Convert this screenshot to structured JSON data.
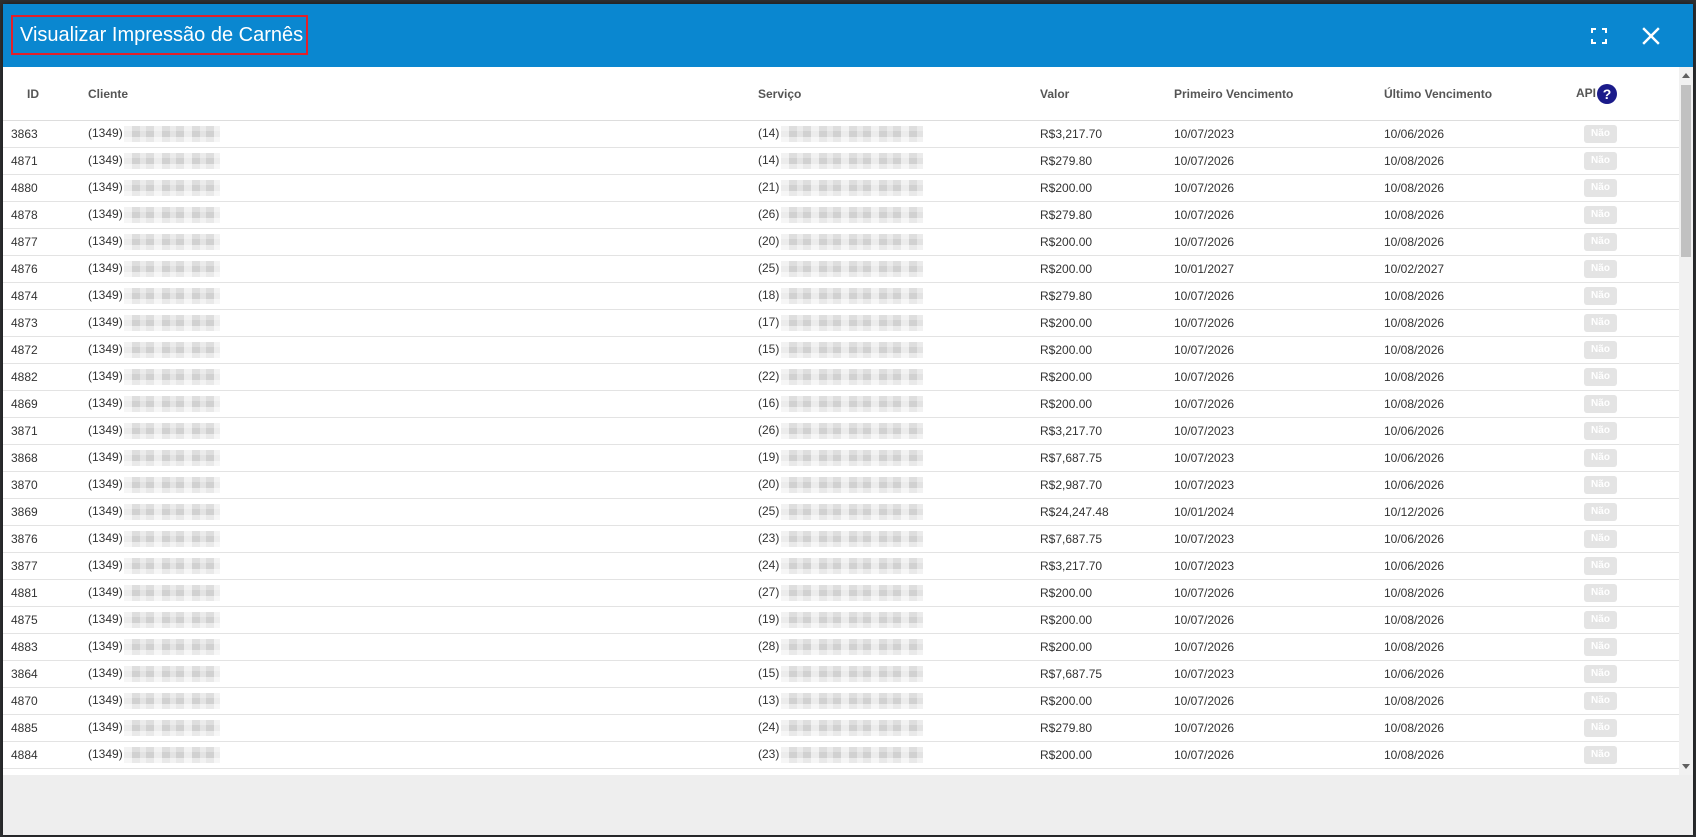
{
  "modal": {
    "title": "Visualizar Impressão de Carnês",
    "header_color": "#0a87d0"
  },
  "table": {
    "columns": {
      "id": "ID",
      "cliente": "Cliente",
      "servico": "Serviço",
      "valor": "Valor",
      "primeiro_vencimento": "Primeiro Vencimento",
      "ultimo_vencimento": "Último Vencimento",
      "api": "API"
    },
    "help_icon": "question-circle-icon",
    "rows": [
      {
        "id": "3863",
        "cliente": "(1349)",
        "servico": "(14)",
        "valor": "R$3,217.70",
        "pv": "10/07/2023",
        "uv": "10/06/2026",
        "api": "Não"
      },
      {
        "id": "4871",
        "cliente": "(1349)",
        "servico": "(14)",
        "valor": "R$279.80",
        "pv": "10/07/2026",
        "uv": "10/08/2026",
        "api": "Não"
      },
      {
        "id": "4880",
        "cliente": "(1349)",
        "servico": "(21)",
        "valor": "R$200.00",
        "pv": "10/07/2026",
        "uv": "10/08/2026",
        "api": "Não"
      },
      {
        "id": "4878",
        "cliente": "(1349)",
        "servico": "(26)",
        "valor": "R$279.80",
        "pv": "10/07/2026",
        "uv": "10/08/2026",
        "api": "Não"
      },
      {
        "id": "4877",
        "cliente": "(1349)",
        "servico": "(20)",
        "valor": "R$200.00",
        "pv": "10/07/2026",
        "uv": "10/08/2026",
        "api": "Não"
      },
      {
        "id": "4876",
        "cliente": "(1349)",
        "servico": "(25)",
        "valor": "R$200.00",
        "pv": "10/01/2027",
        "uv": "10/02/2027",
        "api": "Não"
      },
      {
        "id": "4874",
        "cliente": "(1349)",
        "servico": "(18)",
        "valor": "R$279.80",
        "pv": "10/07/2026",
        "uv": "10/08/2026",
        "api": "Não"
      },
      {
        "id": "4873",
        "cliente": "(1349)",
        "servico": "(17)",
        "valor": "R$200.00",
        "pv": "10/07/2026",
        "uv": "10/08/2026",
        "api": "Não"
      },
      {
        "id": "4872",
        "cliente": "(1349)",
        "servico": "(15)",
        "valor": "R$200.00",
        "pv": "10/07/2026",
        "uv": "10/08/2026",
        "api": "Não"
      },
      {
        "id": "4882",
        "cliente": "(1349)",
        "servico": "(22)",
        "valor": "R$200.00",
        "pv": "10/07/2026",
        "uv": "10/08/2026",
        "api": "Não"
      },
      {
        "id": "4869",
        "cliente": "(1349)",
        "servico": "(16)",
        "valor": "R$200.00",
        "pv": "10/07/2026",
        "uv": "10/08/2026",
        "api": "Não"
      },
      {
        "id": "3871",
        "cliente": "(1349)",
        "servico": "(26)",
        "valor": "R$3,217.70",
        "pv": "10/07/2023",
        "uv": "10/06/2026",
        "api": "Não"
      },
      {
        "id": "3868",
        "cliente": "(1349)",
        "servico": "(19)",
        "valor": "R$7,687.75",
        "pv": "10/07/2023",
        "uv": "10/06/2026",
        "api": "Não"
      },
      {
        "id": "3870",
        "cliente": "(1349)",
        "servico": "(20)",
        "valor": "R$2,987.70",
        "pv": "10/07/2023",
        "uv": "10/06/2026",
        "api": "Não"
      },
      {
        "id": "3869",
        "cliente": "(1349)",
        "servico": "(25)",
        "valor": "R$24,247.48",
        "pv": "10/01/2024",
        "uv": "10/12/2026",
        "api": "Não"
      },
      {
        "id": "3876",
        "cliente": "(1349)",
        "servico": "(23)",
        "valor": "R$7,687.75",
        "pv": "10/07/2023",
        "uv": "10/06/2026",
        "api": "Não"
      },
      {
        "id": "3877",
        "cliente": "(1349)",
        "servico": "(24)",
        "valor": "R$3,217.70",
        "pv": "10/07/2023",
        "uv": "10/06/2026",
        "api": "Não"
      },
      {
        "id": "4881",
        "cliente": "(1349)",
        "servico": "(27)",
        "valor": "R$200.00",
        "pv": "10/07/2026",
        "uv": "10/08/2026",
        "api": "Não"
      },
      {
        "id": "4875",
        "cliente": "(1349)",
        "servico": "(19)",
        "valor": "R$200.00",
        "pv": "10/07/2026",
        "uv": "10/08/2026",
        "api": "Não"
      },
      {
        "id": "4883",
        "cliente": "(1349)",
        "servico": "(28)",
        "valor": "R$200.00",
        "pv": "10/07/2026",
        "uv": "10/08/2026",
        "api": "Não"
      },
      {
        "id": "3864",
        "cliente": "(1349)",
        "servico": "(15)",
        "valor": "R$7,687.75",
        "pv": "10/07/2023",
        "uv": "10/06/2026",
        "api": "Não"
      },
      {
        "id": "4870",
        "cliente": "(1349)",
        "servico": "(13)",
        "valor": "R$200.00",
        "pv": "10/07/2026",
        "uv": "10/08/2026",
        "api": "Não"
      },
      {
        "id": "4885",
        "cliente": "(1349)",
        "servico": "(24)",
        "valor": "R$279.80",
        "pv": "10/07/2026",
        "uv": "10/08/2026",
        "api": "Não"
      },
      {
        "id": "4884",
        "cliente": "(1349)",
        "servico": "(23)",
        "valor": "R$200.00",
        "pv": "10/07/2026",
        "uv": "10/08/2026",
        "api": "Não"
      }
    ]
  },
  "icons": {
    "expand": "fullscreen-icon",
    "close": "close-icon"
  }
}
